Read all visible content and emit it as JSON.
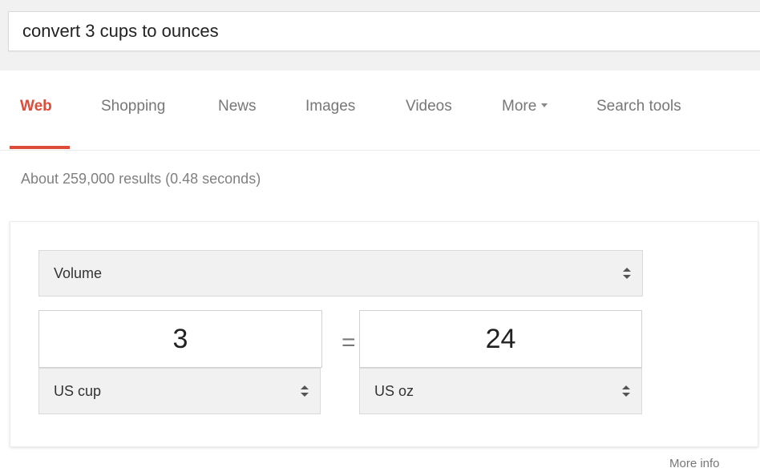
{
  "search": {
    "query": "convert 3 cups to ounces"
  },
  "tabs": [
    {
      "label": "Web",
      "active": true
    },
    {
      "label": "Shopping"
    },
    {
      "label": "News"
    },
    {
      "label": "Images"
    },
    {
      "label": "Videos"
    },
    {
      "label": "More"
    },
    {
      "label": "Search tools"
    }
  ],
  "results": {
    "stats": "About 259,000 results (0.48 seconds)"
  },
  "converter": {
    "category": "Volume",
    "left": {
      "value": "3",
      "unit": "US cup"
    },
    "equals": "=",
    "right": {
      "value": "24",
      "unit": "US oz"
    }
  },
  "footer": {
    "more_info": "More info"
  },
  "colors": {
    "accent": "#dd4b39",
    "band": "#f1f1f1"
  }
}
